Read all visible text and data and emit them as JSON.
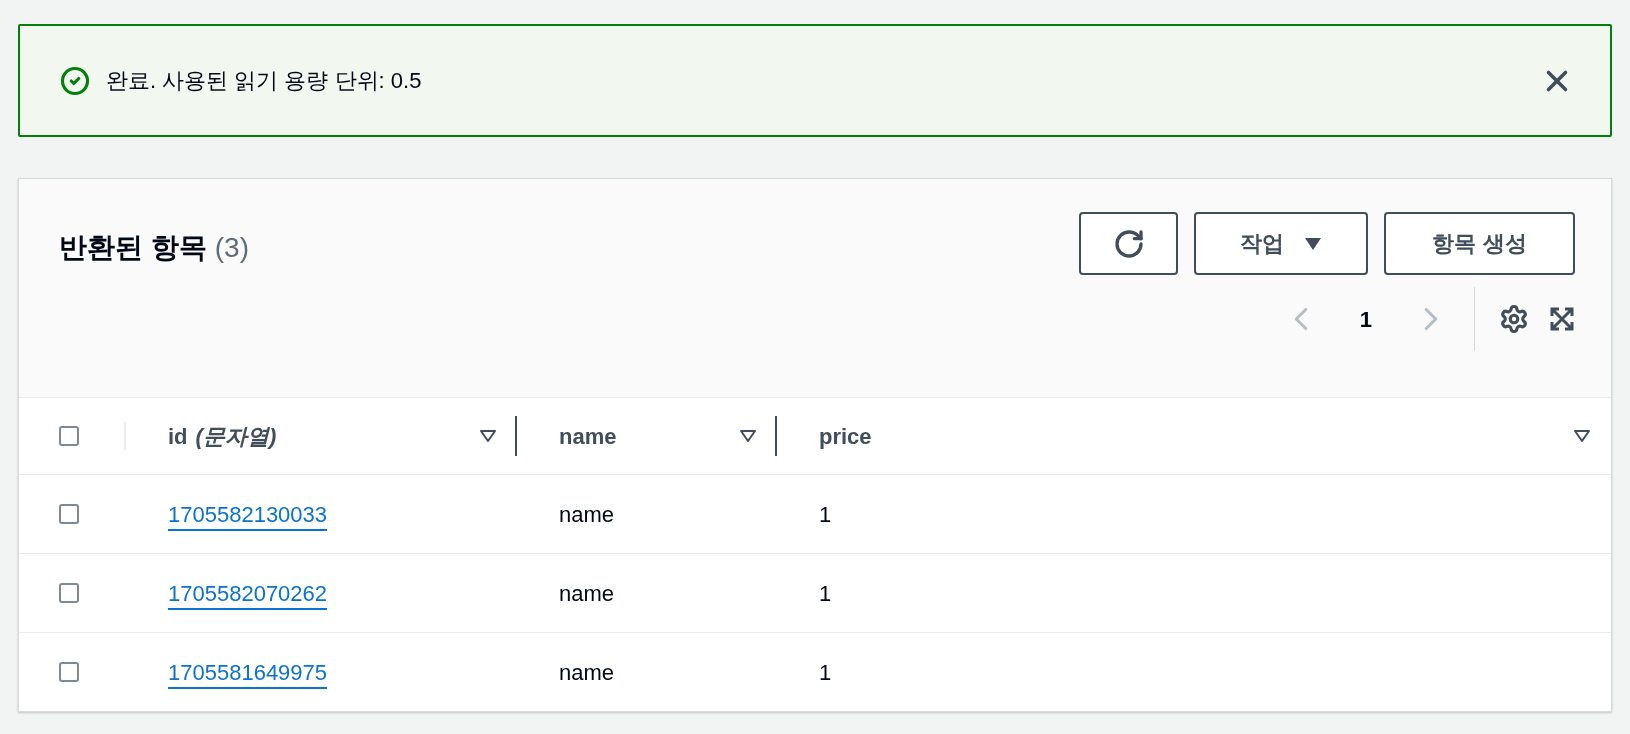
{
  "banner": {
    "kind": "success",
    "message": "완료. 사용된 읽기 용량 단위: 0.5"
  },
  "panel": {
    "title": "반환된 항목",
    "count": "(3)",
    "actions": [
      {
        "kind": "refresh"
      },
      {
        "kind": "dropdown",
        "label": "작업"
      },
      {
        "kind": "text",
        "label": "항목 생성"
      }
    ],
    "pagination": {
      "prev_disabled": true,
      "next_disabled": true,
      "pages": [
        {
          "label": "1",
          "selected": true
        }
      ]
    }
  },
  "table": {
    "select_all_checked": false,
    "columns": [
      {
        "name": "id",
        "type": "(문자열)"
      },
      {
        "name": "name"
      },
      {
        "name": "price"
      }
    ],
    "rows": [
      {
        "checked": false,
        "cells": [
          "1705582130033",
          "name",
          "1"
        ]
      },
      {
        "checked": false,
        "cells": [
          "1705582070262",
          "name",
          "1"
        ]
      },
      {
        "checked": false,
        "cells": [
          "1705581649975",
          "name",
          "1"
        ]
      }
    ]
  }
}
